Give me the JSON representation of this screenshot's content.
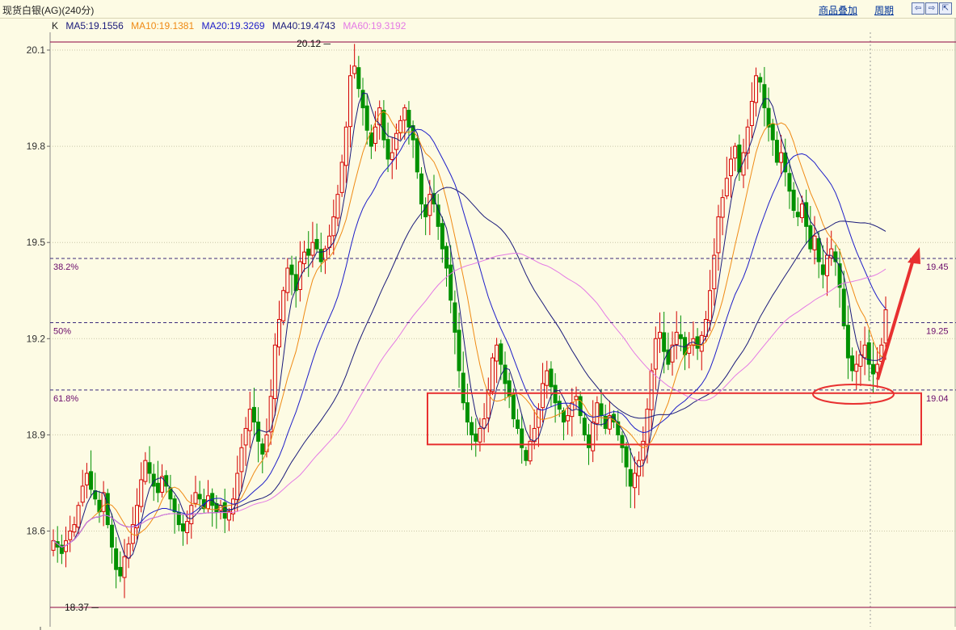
{
  "header": {
    "title": "现货白银(AG)(240分)",
    "overlay_label": "商品叠加",
    "period_label": "周期",
    "nav": {
      "left": "⇦",
      "right": "⇨",
      "expand": "⇱"
    }
  },
  "legend": {
    "k_label": "K",
    "items": [
      {
        "text": "MA5:19.1556",
        "color": "#1a1a7a"
      },
      {
        "text": "MA10:19.1381",
        "color": "#ef8a14"
      },
      {
        "text": "MA20:19.3269",
        "color": "#1d1dc8"
      },
      {
        "text": "MA40:19.4743",
        "color": "#1a1a7a"
      },
      {
        "text": "MA60:19.3192",
        "color": "#e47ae4"
      }
    ]
  },
  "chart_data": {
    "type": "candlestick",
    "ylim": [
      18.44,
      20.2
    ],
    "yticks": [
      "20.1",
      "19.8",
      "19.5",
      "19.2",
      "18.9",
      "18.6"
    ],
    "max_label": "20.12",
    "min_label": "18.37",
    "fib_levels": [
      {
        "label": "38.2%",
        "value": 19.45,
        "value_label": "19.45"
      },
      {
        "label": "50%",
        "value": 19.25,
        "value_label": "19.25"
      },
      {
        "label": "61.8%",
        "value": 19.04,
        "value_label": "19.04"
      }
    ],
    "colors": {
      "up": "#d40000",
      "down": "#009100",
      "grid": "#c9c6a8",
      "fib": "#3a2a7a",
      "bound": "#8c0040",
      "annotation": "#e83030"
    },
    "support_box": [
      18.87,
      19.03
    ],
    "closes": [
      18.57,
      18.55,
      18.53,
      18.57,
      18.6,
      18.62,
      18.68,
      18.74,
      18.78,
      18.73,
      18.7,
      18.66,
      18.72,
      18.62,
      18.55,
      18.48,
      18.46,
      18.52,
      18.56,
      18.62,
      18.68,
      18.76,
      18.82,
      18.78,
      18.74,
      18.72,
      18.77,
      18.74,
      18.7,
      18.66,
      18.62,
      18.6,
      18.63,
      18.68,
      18.72,
      18.7,
      18.67,
      18.71,
      18.68,
      18.66,
      18.68,
      18.64,
      18.66,
      18.7,
      18.78,
      18.86,
      18.92,
      18.98,
      18.94,
      18.88,
      18.84,
      18.9,
      19.02,
      19.18,
      19.26,
      19.35,
      19.42,
      19.4,
      19.35,
      19.44,
      19.47,
      19.46,
      19.5,
      19.48,
      19.44,
      19.48,
      19.52,
      19.58,
      19.65,
      19.75,
      19.86,
      20.02,
      20.05,
      19.98,
      19.92,
      19.85,
      19.8,
      19.86,
      19.92,
      19.82,
      19.76,
      19.78,
      19.84,
      19.88,
      19.92,
      19.86,
      19.82,
      19.72,
      19.62,
      19.58,
      19.65,
      19.62,
      19.55,
      19.48,
      19.42,
      19.32,
      19.22,
      19.1,
      19.0,
      18.94,
      18.9,
      18.88,
      18.92,
      18.95,
      19.04,
      19.14,
      19.18,
      19.12,
      19.06,
      19.02,
      18.95,
      18.92,
      18.86,
      18.82,
      18.88,
      18.92,
      18.98,
      19.06,
      19.1,
      19.05,
      19.0,
      18.98,
      18.94,
      18.96,
      19.0,
      19.02,
      18.96,
      18.9,
      18.86,
      18.94,
      19.0,
      18.96,
      18.92,
      18.96,
      18.94,
      18.9,
      18.86,
      18.8,
      18.74,
      18.78,
      18.82,
      18.88,
      18.98,
      19.1,
      19.2,
      19.22,
      19.16,
      19.12,
      19.18,
      19.22,
      19.2,
      19.15,
      19.18,
      19.2,
      19.17,
      19.21,
      19.26,
      19.35,
      19.46,
      19.58,
      19.64,
      19.7,
      19.76,
      19.8,
      19.72,
      19.78,
      19.86,
      19.94,
      20.02,
      20.0,
      19.92,
      19.86,
      19.82,
      19.75,
      19.78,
      19.72,
      19.66,
      19.6,
      19.58,
      19.62,
      19.55,
      19.48,
      19.52,
      19.44,
      19.4,
      19.46,
      19.48,
      19.44,
      19.36,
      19.24,
      19.14,
      19.1,
      19.12,
      19.15,
      19.18,
      19.12,
      19.09,
      19.12,
      19.18,
      19.29
    ]
  },
  "ma_series": [
    {
      "name": "MA5",
      "period": 5,
      "color": "#1a1a7a"
    },
    {
      "name": "MA10",
      "period": 10,
      "color": "#ef8a14"
    },
    {
      "name": "MA20",
      "period": 20,
      "color": "#1d1dc8"
    },
    {
      "name": "MA40",
      "period": 40,
      "color": "#1a1a7a"
    },
    {
      "name": "MA60",
      "period": 60,
      "color": "#e47ae4"
    }
  ]
}
